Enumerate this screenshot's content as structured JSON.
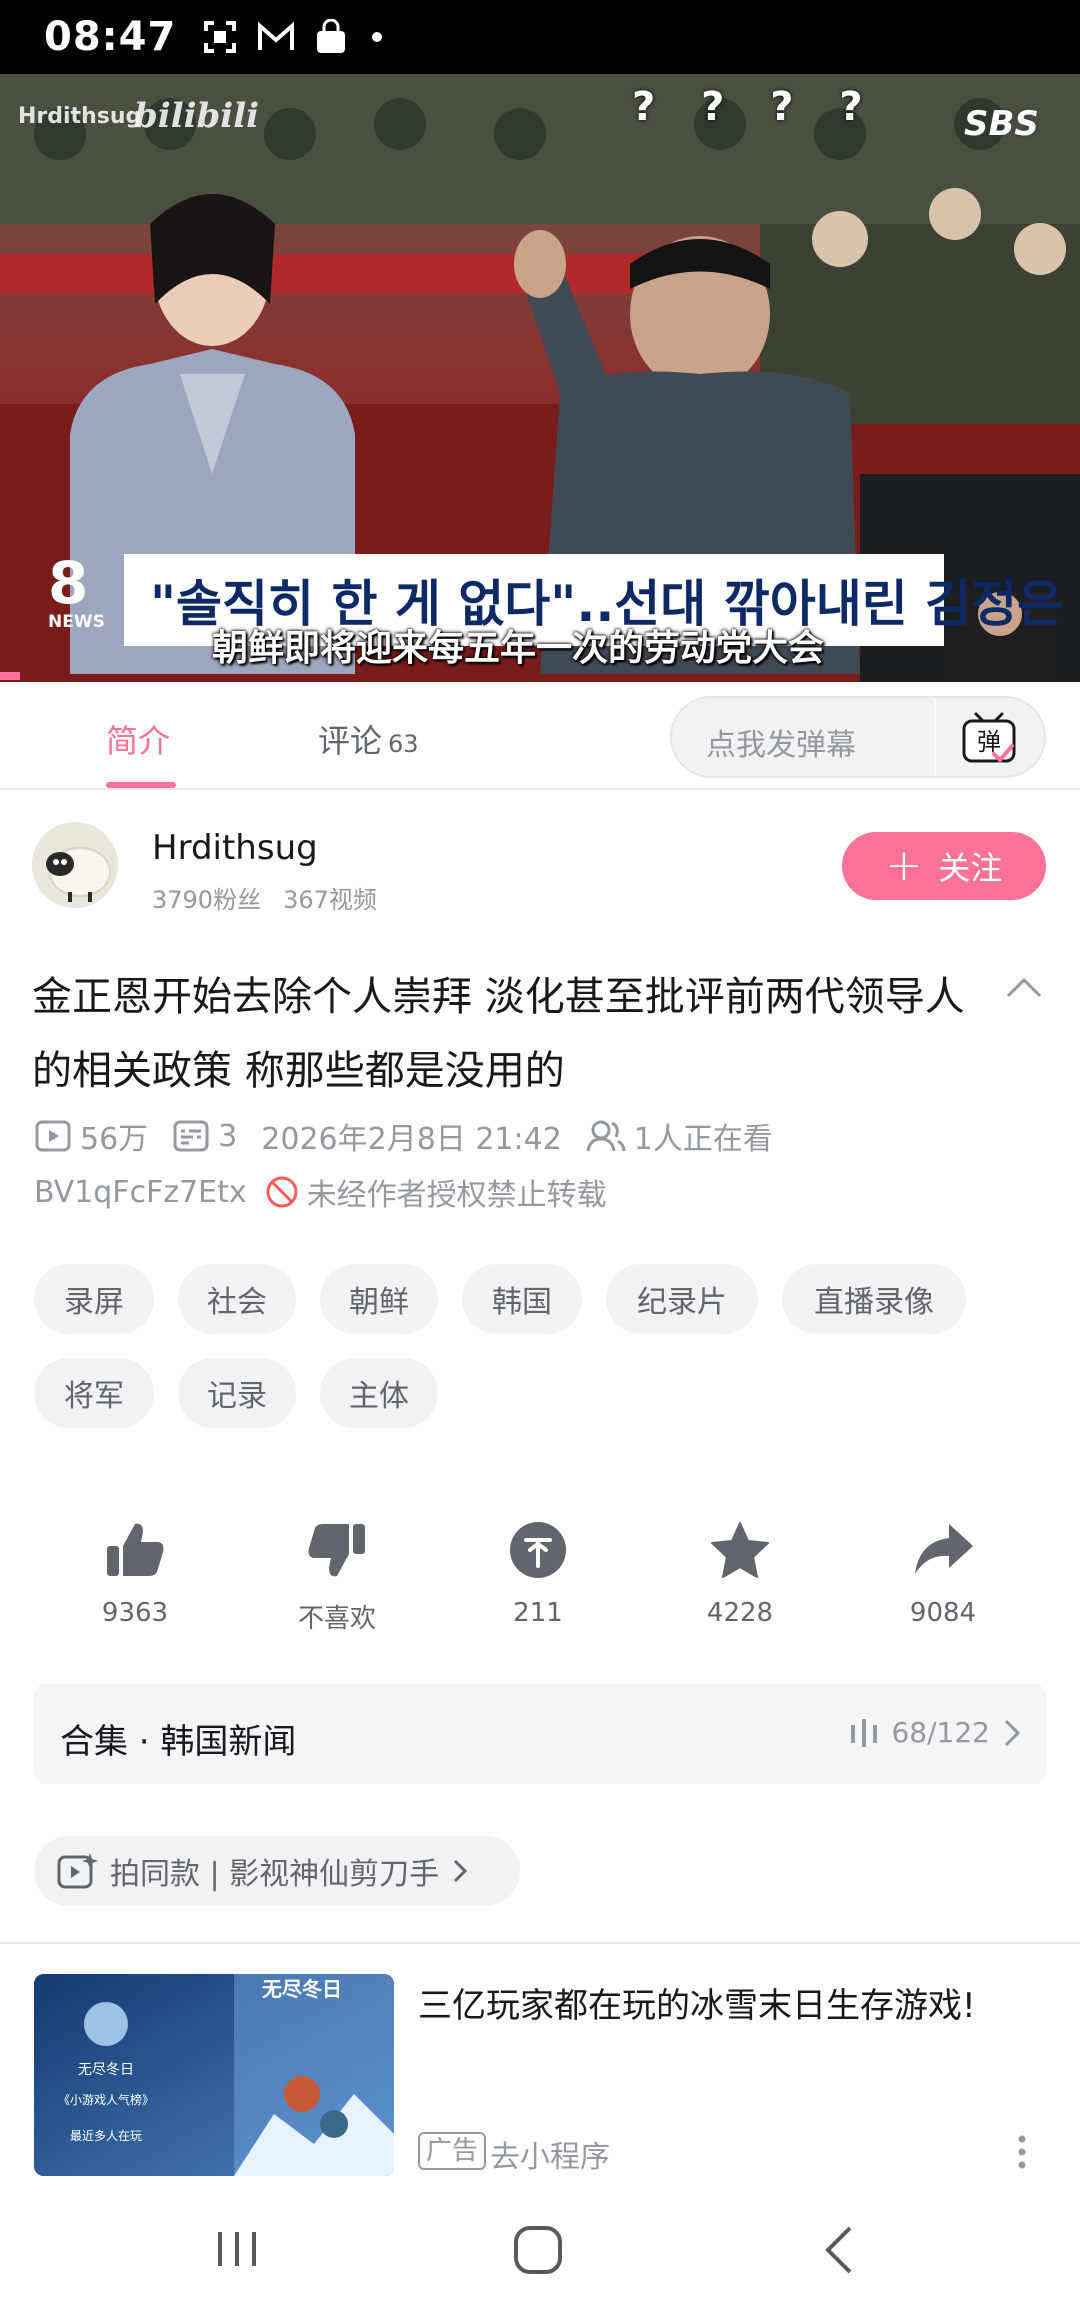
{
  "status_bar": {
    "time": "08:47"
  },
  "video": {
    "watermark_user": "Hrdithsug",
    "watermark_logo": "bilibili",
    "overlay_marks": "? ? ? ?",
    "broadcaster": "SBS",
    "news_logo_number": "8",
    "news_logo_text": "NEWS",
    "headline_korean": "\"솔직히 한 게 없다\"..선대 깎아내린 김정은",
    "subtitle": "朝鲜即将迎来每五年一次的劳动党大会"
  },
  "tabs": [
    {
      "label": "简介"
    },
    {
      "label": "评论",
      "count": "63"
    }
  ],
  "danmaku": {
    "placeholder": "点我发弹幕",
    "icon_char": "弹"
  },
  "uploader": {
    "name": "Hrdithsug",
    "fans": "3790粉丝",
    "videos": "367视频",
    "follow_label": "关注"
  },
  "title": "金正恩开始去除个人崇拜 淡化甚至批评前两代领导人的相关政策 称那些都是没用的",
  "meta": {
    "views": "56万",
    "danmaku_count": "3",
    "date": "2026年2月8日 21:42",
    "watching": "1人正在看",
    "bvid": "BV1qFcFz7Etx",
    "copyright": "未经作者授权禁止转载"
  },
  "tags": [
    "录屏",
    "社会",
    "朝鲜",
    "韩国",
    "纪录片",
    "直播录像",
    "将军",
    "记录",
    "主体"
  ],
  "actions": {
    "like": "9363",
    "dislike": "不喜欢",
    "coin": "211",
    "favorite": "4228",
    "share": "9084"
  },
  "collection": {
    "title": "合集 · 韩国新闻",
    "progress": "68/122"
  },
  "same_style": {
    "label": "拍同款 | 影视神仙剪刀手"
  },
  "ad": {
    "title": "三亿玩家都在玩的冰雪末日生存游戏!",
    "badge": "广告",
    "link": "去小程序",
    "thumb_game_name": "无尽冬日",
    "thumb_line1": "《小游戏人气榜》",
    "thumb_line2": "最近多人在玩"
  },
  "colors": {
    "accent": "#fb7299",
    "muted": "#9499a0",
    "tag_bg": "#f1f2f3"
  }
}
